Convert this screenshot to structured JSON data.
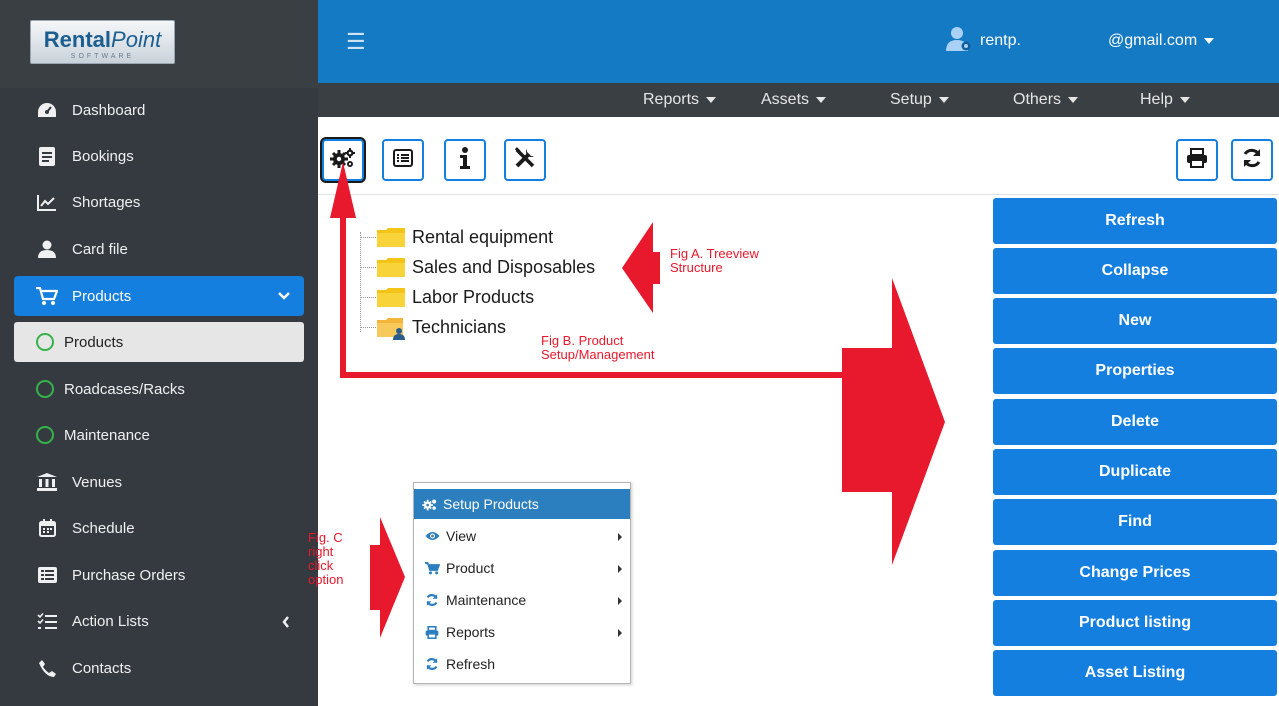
{
  "logo": {
    "brand_bold": "Rental",
    "brand_italic": "Point",
    "brand_sub": "SOFTWARE"
  },
  "sidebar": {
    "items": [
      {
        "label": "Dashboard",
        "icon": "dashboard-icon"
      },
      {
        "label": "Bookings",
        "icon": "bookings-icon"
      },
      {
        "label": "Shortages",
        "icon": "chart-line-icon"
      },
      {
        "label": "Card file",
        "icon": "user-icon"
      },
      {
        "label": "Products",
        "icon": "cart-icon",
        "active": true
      },
      {
        "label": "Products",
        "icon": "circle-icon",
        "sub": true,
        "selected": true
      },
      {
        "label": "Roadcases/Racks",
        "icon": "circle-icon",
        "sub": true
      },
      {
        "label": "Maintenance",
        "icon": "circle-icon",
        "sub": true
      },
      {
        "label": "Venues",
        "icon": "bank-icon"
      },
      {
        "label": "Schedule",
        "icon": "calendar-icon"
      },
      {
        "label": "Purchase Orders",
        "icon": "list-alt-icon"
      },
      {
        "label": "Action Lists",
        "icon": "tasks-icon"
      },
      {
        "label": "Contacts",
        "icon": "phone-icon"
      }
    ]
  },
  "topbar": {
    "user": "rentp.",
    "email": "@gmail.com"
  },
  "menu": [
    "Reports",
    "Assets",
    "Setup",
    "Others",
    "Help"
  ],
  "tree": [
    "Rental equipment",
    "Sales and Disposables",
    "Labor Products",
    "Technicians"
  ],
  "annotations": {
    "fig_a_line1": "Fig A. Treeview",
    "fig_a_line2": "Structure",
    "fig_b_line1": "Fig B. Product",
    "fig_b_line2": "Setup/Management",
    "fig_c_line1": "Fig. C",
    "fig_c_line2": "right",
    "fig_c_line3": "click",
    "fig_c_line4": "option"
  },
  "actions": [
    "Refresh",
    "Collapse",
    "New",
    "Properties",
    "Delete",
    "Duplicate",
    "Find",
    "Change Prices",
    "Product listing",
    "Asset Listing"
  ],
  "context_menu": {
    "header": "Setup Products",
    "items": [
      {
        "label": "View",
        "icon": "eye-icon",
        "submenu": true
      },
      {
        "label": "Product",
        "icon": "cart-icon",
        "submenu": true
      },
      {
        "label": "Maintenance",
        "icon": "refresh-icon",
        "submenu": true
      },
      {
        "label": "Reports",
        "icon": "print-icon",
        "submenu": true
      },
      {
        "label": "Refresh",
        "icon": "sync-icon",
        "submenu": false
      }
    ]
  },
  "colors": {
    "sidebar_bg": "#343a40",
    "topbar_bg": "#147ac4",
    "accent": "#157fe0",
    "annotation_red": "#e8192c"
  }
}
